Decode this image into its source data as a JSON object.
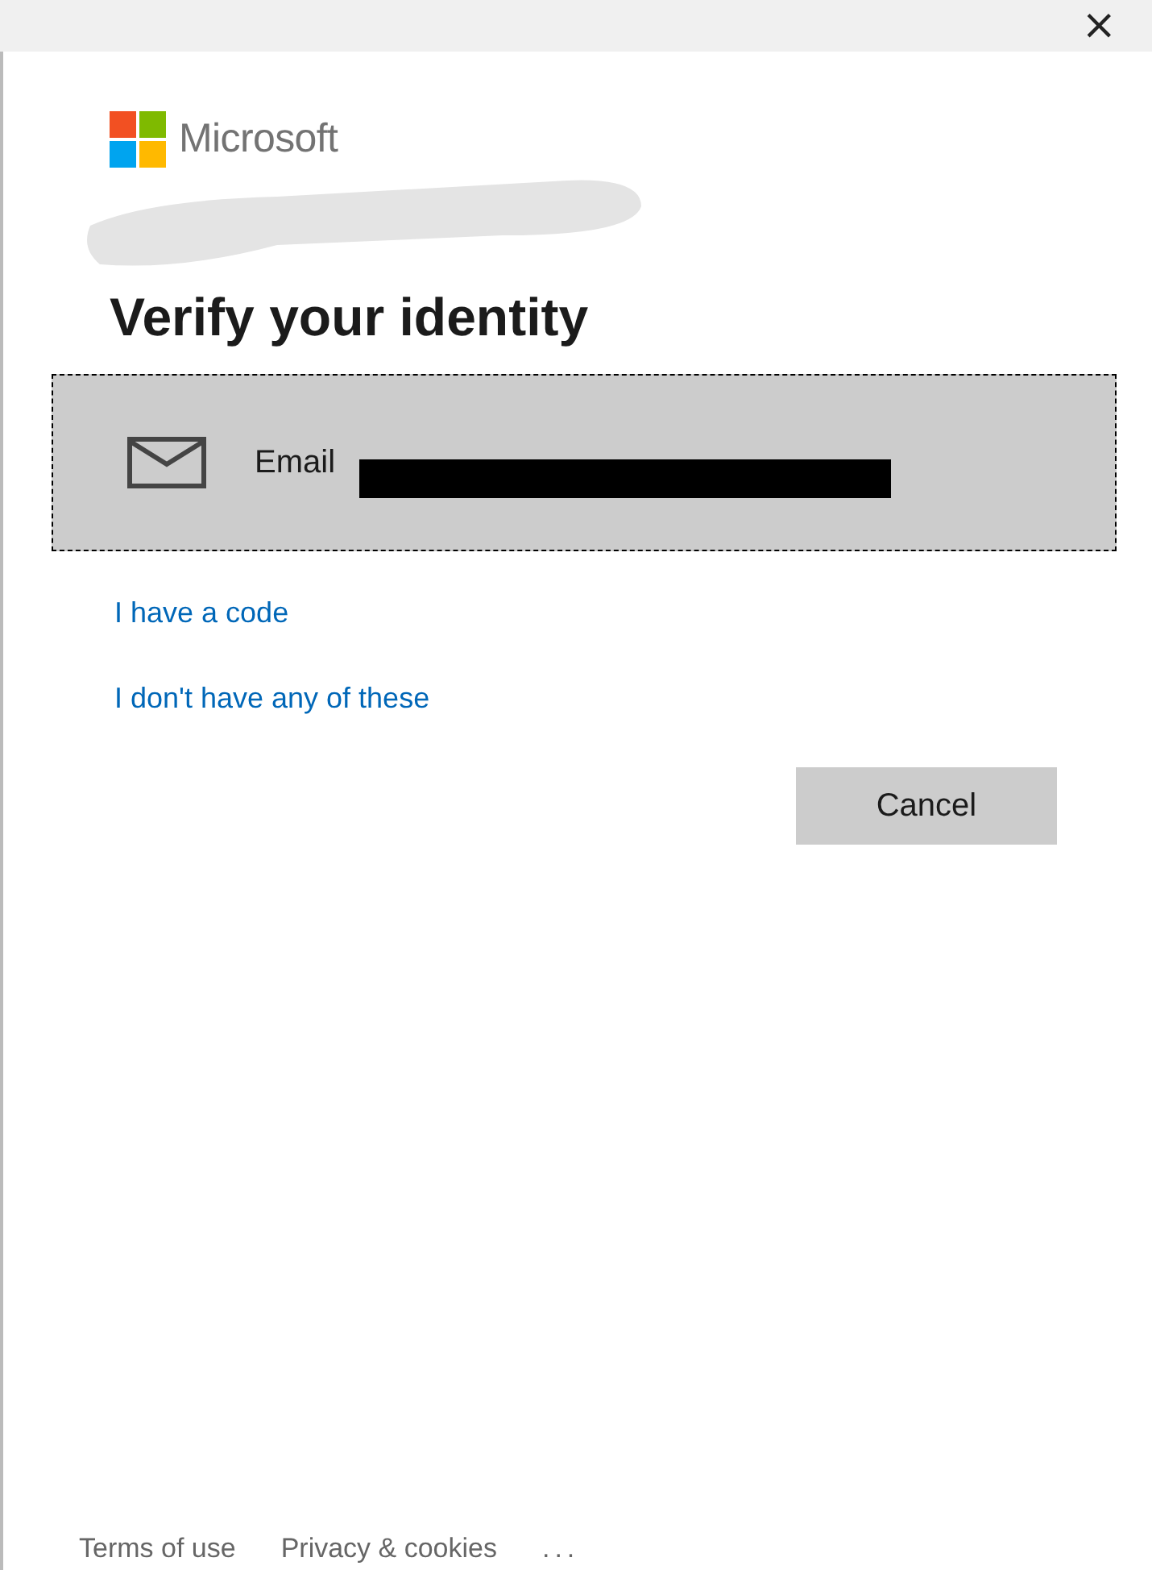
{
  "window": {
    "close": "×"
  },
  "brand": "Microsoft",
  "heading": "Verify your identity",
  "options": [
    {
      "kind": "email",
      "label": "Email",
      "focused": true,
      "redacted": true
    }
  ],
  "links": [
    "I have a code",
    "I don't have any of these"
  ],
  "buttons": [
    "Cancel"
  ],
  "footer": {
    "links": [
      "Terms of use",
      "Privacy & cookies"
    ],
    "more": "..."
  }
}
